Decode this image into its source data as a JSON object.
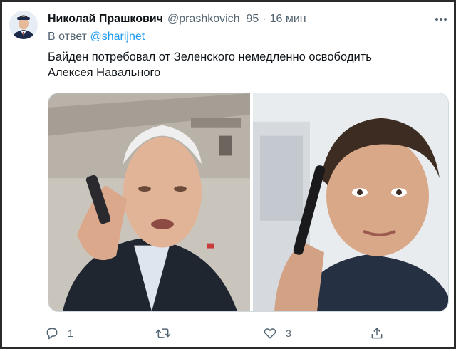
{
  "tweet": {
    "author_name": "Николай Прашкович",
    "handle": "@prashkovich_95",
    "separator": "·",
    "time": "16 мин",
    "reply_prefix": "В ответ",
    "reply_to": "@sharijnet",
    "text": "Байден потребовал от Зеленского немедленно освободить Алексея Навального"
  },
  "actions": {
    "reply_count": "1",
    "retweet_count": "",
    "like_count": "3"
  },
  "icons": {
    "more": "more-horizontal-icon",
    "reply": "speech-bubble-icon",
    "retweet": "retweet-arrows-icon",
    "like": "heart-icon",
    "share": "share-upload-icon"
  },
  "colors": {
    "link": "#1d9bf0",
    "secondary_text": "#536471",
    "primary_text": "#0f1419"
  }
}
